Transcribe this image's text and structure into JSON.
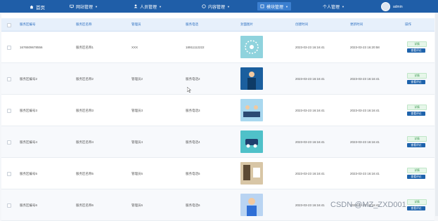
{
  "nav": {
    "home": "首页",
    "items": [
      "网站管理",
      "人员管理",
      "内容管理",
      "模块管理",
      "个人管理"
    ],
    "active_index": 3,
    "user_name": "admin"
  },
  "table": {
    "headers": [
      "服务区编号",
      "服务区名称",
      "管理员",
      "服务电话",
      "封面图片",
      "创建时间",
      "更新时间",
      "操作"
    ],
    "rows": [
      {
        "id": "1676509678556",
        "name": "服务区名称1",
        "manager": "XXX",
        "phone": "18911112222",
        "created": "2023-03-23 16:16:41",
        "updated": "2023-03-23 16:20:58"
      },
      {
        "id": "服务区编号2",
        "name": "服务区名称2",
        "manager": "管理员2",
        "phone": "服务电话2",
        "created": "2023-03-23 16:16:41",
        "updated": "2023-03-23 16:16:41"
      },
      {
        "id": "服务区编号3",
        "name": "服务区名称3",
        "manager": "管理员3",
        "phone": "服务电话3",
        "created": "2023-03-23 16:16:41",
        "updated": "2023-03-23 16:16:41"
      },
      {
        "id": "服务区编号4",
        "name": "服务区名称4",
        "manager": "管理员4",
        "phone": "服务电话4",
        "created": "2023-03-23 16:16:41",
        "updated": "2023-03-23 16:16:41"
      },
      {
        "id": "服务区编号5",
        "name": "服务区名称5",
        "manager": "管理员5",
        "phone": "服务电话5",
        "created": "2023-03-23 16:16:41",
        "updated": "2023-03-23 16:16:41"
      },
      {
        "id": "服务区编号6",
        "name": "服务区名称6",
        "manager": "管理员6",
        "phone": "服务电话6",
        "created": "2023-03-23 16:16:41",
        "updated": "2023-03-23 16:16:41"
      }
    ],
    "detail_label": "详情",
    "review_label": "查看评论"
  },
  "watermark": "CSDN @MZ_ZXD001",
  "colors": {
    "topbar": "#1f5ea8",
    "header_text": "#2d6fc0",
    "primary_button": "#1e63ac",
    "detail_button": "#e6f6e9"
  }
}
